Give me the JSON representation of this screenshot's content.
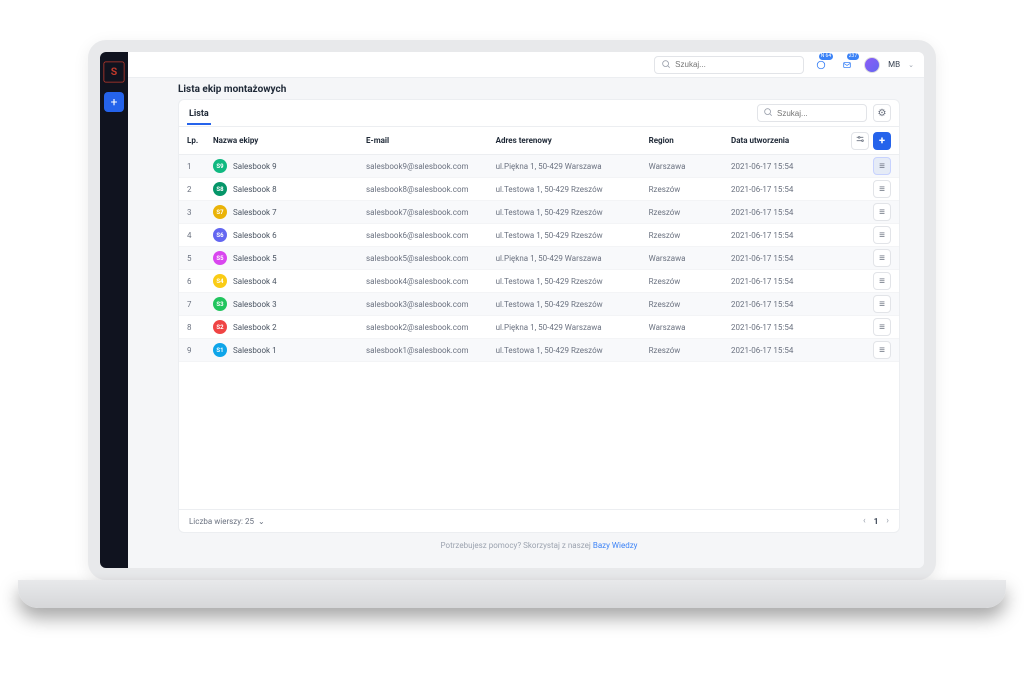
{
  "header": {
    "search_placeholder": "Szukaj...",
    "notif_badge1": "N 64",
    "notif_badge2": "237",
    "user_label": "MB"
  },
  "page": {
    "title": "Lista ekip montażowych"
  },
  "tabs": [
    "Lista"
  ],
  "panel": {
    "search_placeholder": "Szukaj..."
  },
  "columns": {
    "lp": "Lp.",
    "name": "Nazwa ekipy",
    "email": "E-mail",
    "address": "Adres terenowy",
    "region": "Region",
    "created": "Data utworzenia"
  },
  "rows": [
    {
      "lp": "1",
      "badge": "S9",
      "color": "#10b981",
      "name": "Salesbook 9",
      "email": "salesbook9@salesbook.com",
      "address": "ul.Piękna 1, 50-429 Warszawa",
      "region": "Warszawa",
      "created": "2021-06-17 15:54"
    },
    {
      "lp": "2",
      "badge": "S8",
      "color": "#059669",
      "name": "Salesbook 8",
      "email": "salesbook8@salesbook.com",
      "address": "ul.Testowa 1, 50-429 Rzeszów",
      "region": "Rzeszów",
      "created": "2021-06-17 15:54"
    },
    {
      "lp": "3",
      "badge": "S7",
      "color": "#eab308",
      "name": "Salesbook 7",
      "email": "salesbook7@salesbook.com",
      "address": "ul.Testowa 1, 50-429 Rzeszów",
      "region": "Rzeszów",
      "created": "2021-06-17 15:54"
    },
    {
      "lp": "4",
      "badge": "S6",
      "color": "#6366f1",
      "name": "Salesbook 6",
      "email": "salesbook6@salesbook.com",
      "address": "ul.Testowa 1, 50-429 Rzeszów",
      "region": "Rzeszów",
      "created": "2021-06-17 15:54"
    },
    {
      "lp": "5",
      "badge": "S5",
      "color": "#d946ef",
      "name": "Salesbook 5",
      "email": "salesbook5@salesbook.com",
      "address": "ul.Piękna 1, 50-429 Warszawa",
      "region": "Warszawa",
      "created": "2021-06-17 15:54"
    },
    {
      "lp": "6",
      "badge": "S4",
      "color": "#facc15",
      "name": "Salesbook 4",
      "email": "salesbook4@salesbook.com",
      "address": "ul.Testowa 1, 50-429 Rzeszów",
      "region": "Rzeszów",
      "created": "2021-06-17 15:54"
    },
    {
      "lp": "7",
      "badge": "S3",
      "color": "#22c55e",
      "name": "Salesbook 3",
      "email": "salesbook3@salesbook.com",
      "address": "ul.Testowa 1, 50-429 Rzeszów",
      "region": "Rzeszów",
      "created": "2021-06-17 15:54"
    },
    {
      "lp": "8",
      "badge": "S2",
      "color": "#ef4444",
      "name": "Salesbook 2",
      "email": "salesbook2@salesbook.com",
      "address": "ul.Piękna 1, 50-429 Warszawa",
      "region": "Warszawa",
      "created": "2021-06-17 15:54"
    },
    {
      "lp": "9",
      "badge": "S1",
      "color": "#0ea5e9",
      "name": "Salesbook 1",
      "email": "salesbook1@salesbook.com",
      "address": "ul.Testowa 1, 50-429 Rzeszów",
      "region": "Rzeszów",
      "created": "2021-06-17 15:54"
    }
  ],
  "footer": {
    "rows_label": "Liczba wierszy: 25",
    "page": "1",
    "help_text": "Potrzebujesz pomocy? Skorzystaj z naszej ",
    "help_link": "Bazy Wiedzy"
  }
}
